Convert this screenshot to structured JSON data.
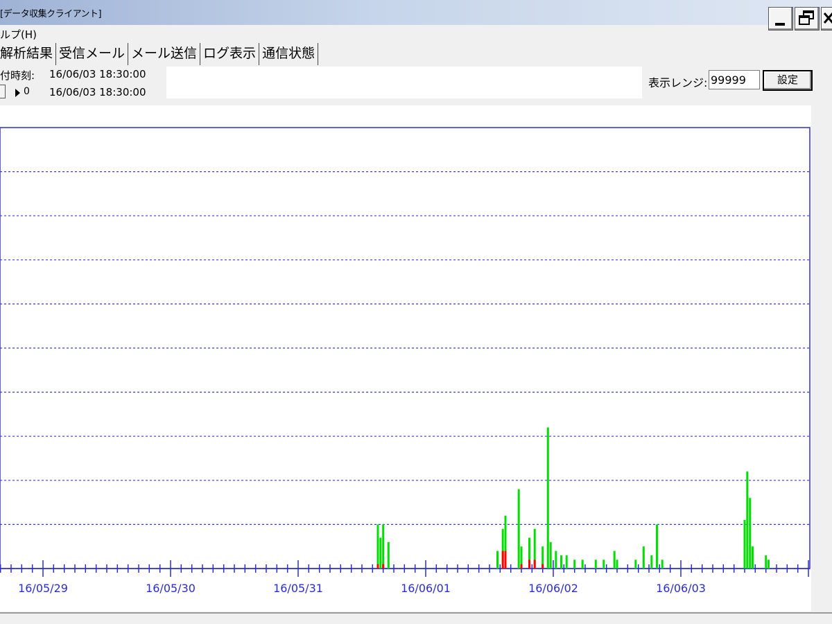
{
  "window": {
    "title": "[データ収集クライアント]",
    "controls": {
      "minimize": "minimize-icon",
      "restore": "restore-icon",
      "close": "close-icon"
    }
  },
  "menu": {
    "help": "ルプ(H)"
  },
  "tabs": [
    "解析結果",
    "受信メール",
    "メール送信",
    "ログ表示",
    "通信状態"
  ],
  "info": {
    "receive_time_label": "付時刻:",
    "receive_time_value": "16/06/03 18:30:00",
    "arrow_count": "0",
    "current_time_value": "16/06/03 18:30:00"
  },
  "range": {
    "label": "表示レンジ:",
    "value": "99999",
    "set_button": "設定"
  },
  "colors": {
    "axis": "#2b2bd6",
    "grid": "#3a3ad0",
    "series_green": "#00e000",
    "series_red": "#ff0000",
    "titlebar": "#c6d5ea"
  },
  "chart_data": {
    "type": "area",
    "x_tick_labels": [
      "16/05/29",
      "16/05/30",
      "16/05/31",
      "16/06/01",
      "16/06/02",
      "16/06/03"
    ],
    "ylim": [
      0,
      10
    ],
    "grid": "dashed-horizontal",
    "series": [
      {
        "points": [
          [
            "16/05/31 15:00",
            1.0
          ],
          [
            "16/05/31 15:30",
            0.7
          ],
          [
            "16/05/31 16:00",
            1.0
          ],
          [
            "16/05/31 17:00",
            0.6
          ],
          [
            "16/06/01 13:30",
            0.4
          ],
          [
            "16/06/01 14:30",
            0.9
          ],
          [
            "16/06/01 15:00",
            1.2
          ],
          [
            "16/06/01 17:30",
            1.8
          ],
          [
            "16/06/01 18:00",
            0.5
          ],
          [
            "16/06/01 19:30",
            0.7
          ],
          [
            "16/06/01 20:30",
            0.9
          ],
          [
            "16/06/01 22:00",
            0.5
          ],
          [
            "16/06/01 23:00",
            3.2
          ],
          [
            "16/06/01 23:30",
            0.6
          ],
          [
            "16/06/02 00:30",
            0.4
          ],
          [
            "16/06/02 01:30",
            0.3
          ],
          [
            "16/06/02 02:30",
            0.3
          ],
          [
            "16/06/02 04:00",
            0.2
          ],
          [
            "16/06/02 05:30",
            0.2
          ],
          [
            "16/06/02 08:00",
            0.2
          ],
          [
            "16/06/02 09:30",
            0.2
          ],
          [
            "16/06/02 11:30",
            0.4
          ],
          [
            "16/06/02 12:00",
            0.2
          ],
          [
            "16/06/02 15:30",
            0.2
          ],
          [
            "16/06/02 17:00",
            0.5
          ],
          [
            "16/06/02 18:30",
            0.3
          ],
          [
            "16/06/02 19:30",
            1.0
          ],
          [
            "16/06/02 20:30",
            0.2
          ],
          [
            "16/06/03 12:00",
            1.1
          ],
          [
            "16/06/03 12:30",
            2.2
          ],
          [
            "16/06/03 13:00",
            1.6
          ],
          [
            "16/06/03 13:30",
            0.5
          ],
          [
            "16/06/03 16:00",
            0.3
          ],
          [
            "16/06/03 16:30",
            0.2
          ]
        ]
      },
      {
        "points": [
          [
            "16/05/31 15:00",
            0.1
          ],
          [
            "16/05/31 16:00",
            0.1
          ],
          [
            "16/06/01 14:30",
            0.4
          ],
          [
            "16/06/01 15:00",
            0.4
          ],
          [
            "16/06/01 18:00",
            0.1
          ],
          [
            "16/06/01 19:30",
            0.2
          ],
          [
            "16/06/01 20:30",
            0.2
          ],
          [
            "16/06/01 22:00",
            0.1
          ]
        ]
      }
    ]
  }
}
